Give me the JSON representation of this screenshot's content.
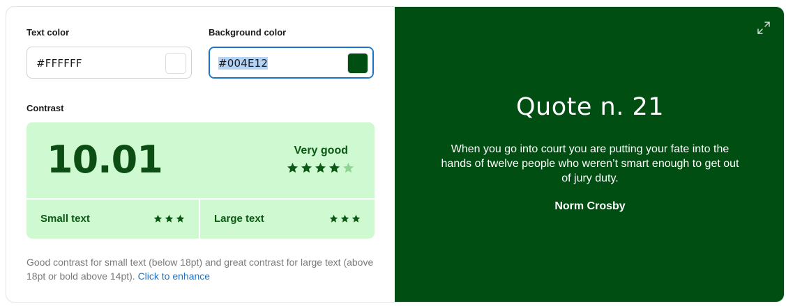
{
  "text_color": {
    "label": "Text color",
    "value": "#FFFFFF",
    "swatch": "#FFFFFF"
  },
  "background_color": {
    "label": "Background color",
    "value": "#004E12",
    "swatch": "#004E12"
  },
  "contrast": {
    "label": "Contrast",
    "ratio": "10.01",
    "rating": "Very good",
    "stars_filled": 4,
    "stars_total": 5,
    "small_text": {
      "label": "Small text",
      "stars": 3
    },
    "large_text": {
      "label": "Large text",
      "stars": 3
    },
    "panel_color": "#CFF9D1",
    "accent_color": "#0B4D12"
  },
  "description": {
    "text": "Good contrast for small text (below 18pt) and great contrast for large text (above 18pt or bold above 14pt).",
    "link": "Click to enhance"
  },
  "preview": {
    "title": "Quote n. 21",
    "quote": "When you go into court you are putting your fate into the hands of twelve people who weren’t smart enough to get out of jury duty.",
    "author": "Norm Crosby",
    "expand_icon": "expand-icon"
  }
}
